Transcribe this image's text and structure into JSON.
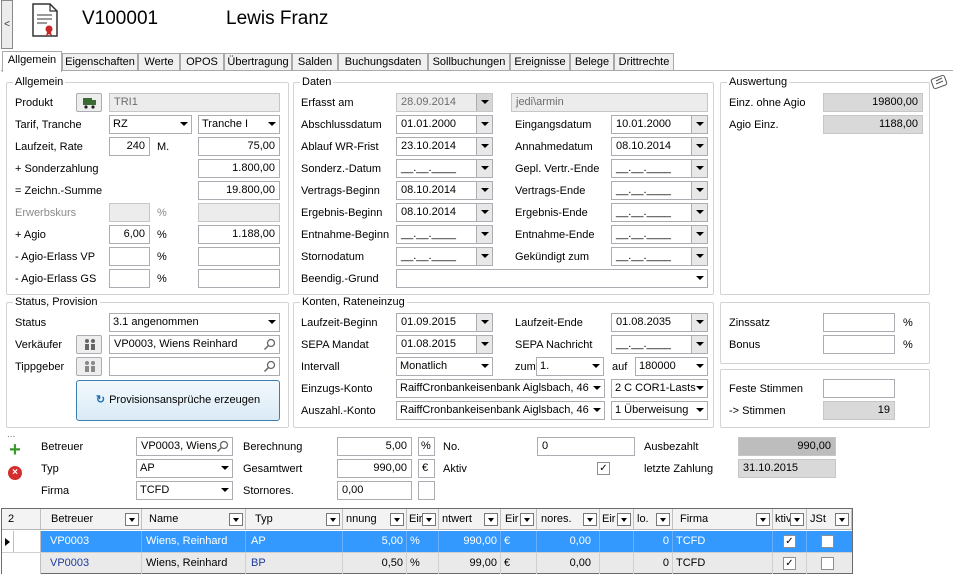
{
  "header": {
    "side_tab": "<",
    "record_id": "V100001",
    "customer_name": "Lewis Franz"
  },
  "tabs": [
    "Allgemein",
    "Eigenschaften",
    "Werte",
    "OPOS",
    "Übertragung",
    "Salden",
    "Buchungsdaten",
    "Sollbuchungen",
    "Ereignisse",
    "Belege",
    "Drittrechte"
  ],
  "allgemein": {
    "title": "Allgemein",
    "produkt_label": "Produkt",
    "produkt_value": "TRI1",
    "tarif_label": "Tarif, Tranche",
    "tarif_value": "RZ",
    "tranche_value": "Tranche I",
    "laufzeit_label": "Laufzeit, Rate",
    "laufzeit_value": "240",
    "laufzeit_unit": "M.",
    "rate_value": "75,00",
    "sonder_label": "+ Sonderzahlung",
    "sonder_value": "1.800,00",
    "zeichn_label": "= Zeichn.-Summe",
    "zeichn_value": "19.800,00",
    "erwerbskurs_label": "Erwerbskurs",
    "erwerbskurs_pct": "%",
    "agio_label": "+ Agio",
    "agio_value": "6,00",
    "agio_pct": "%",
    "agio_amount": "1.188,00",
    "erlass_vp_label": "- Agio-Erlass VP",
    "erlass_vp_pct": "%",
    "erlass_gs_label": "- Agio-Erlass GS",
    "erlass_gs_pct": "%"
  },
  "daten": {
    "title": "Daten",
    "erfasst_label": "Erfasst am",
    "erfasst_value": "28.09.2014",
    "user_value": "jedi\\armin",
    "abschluss_label": "Abschlussdatum",
    "abschluss_value": "01.01.2000",
    "eingang_label": "Eingangsdatum",
    "eingang_value": "10.01.2000",
    "ablauf_label": "Ablauf WR-Frist",
    "ablauf_value": "23.10.2014",
    "annahme_label": "Annahmedatum",
    "annahme_value": "08.10.2014",
    "sonderz_label": "Sonderz.-Datum",
    "sonderz_value": "__.__.____",
    "gepl_label": "Gepl. Vertr.-Ende",
    "gepl_value": "__.__.____",
    "vbeginn_label": "Vertrags-Beginn",
    "vbeginn_value": "08.10.2014",
    "vende_label": "Vertrags-Ende",
    "vende_value": "__.__.____",
    "ebeginn_label": "Ergebnis-Beginn",
    "ebeginn_value": "08.10.2014",
    "eende_label": "Ergebnis-Ende",
    "eende_value": "__.__.____",
    "entbeginn_label": "Entnahme-Beginn",
    "entbeginn_value": "__.__.____",
    "entende_label": "Entnahme-Ende",
    "entende_value": "__.__.____",
    "storno_label": "Stornodatum",
    "storno_value": "__.__.____",
    "gekuendigt_label": "Gekündigt zum",
    "gekuendigt_value": "__.__.____",
    "beendig_label": "Beendig.-Grund",
    "beendig_value": ""
  },
  "auswertung": {
    "title": "Auswertung",
    "einz_label": "Einz. ohne Agio",
    "einz_value": "19800,00",
    "agio_label": "Agio Einz.",
    "agio_value": "1188,00"
  },
  "status": {
    "title": "Status, Provision",
    "status_label": "Status",
    "status_value": "3.1 angenommen",
    "verkaeufer_label": "Verkäufer",
    "verkaeufer_value": "VP0003, Wiens Reinhard",
    "tippgeber_label": "Tippgeber",
    "tippgeber_value": "",
    "prov_button": "Provisionsansprüche erzeugen"
  },
  "konten": {
    "title": "Konten, Rateneinzug",
    "lbeginn_label": "Laufzeit-Beginn",
    "lbeginn_value": "01.09.2015",
    "lende_label": "Laufzeit-Ende",
    "lende_value": "01.08.2035",
    "sepa_label": "SEPA Mandat",
    "sepa_value": "01.08.2015",
    "sepan_label": "SEPA Nachricht",
    "sepan_value": "__.__.____",
    "intervall_label": "Intervall",
    "intervall_value": "Monatlich",
    "zum_label": "zum",
    "zum_value": "1.",
    "auf_label": "auf",
    "auf_value": "180000",
    "einzug_label": "Einzugs-Konto",
    "einzug_value": "RaiffCronbankeisenbank Aiglsbach, 46",
    "einzug_type": "2 C COR1-Lasts",
    "auszahl_label": "Auszahl.-Konto",
    "auszahl_value": "RaiffCronbankeisenbank Aiglsbach, 46",
    "auszahl_type": "1 Überweisung"
  },
  "zins": {
    "zinssatz_label": "Zinssatz",
    "zinssatz_unit": "%",
    "bonus_label": "Bonus",
    "bonus_unit": "%"
  },
  "stimmen": {
    "feste_label": "Feste Stimmen",
    "stimmen_label": "-> Stimmen",
    "stimmen_value": "19"
  },
  "prov_detail": {
    "dots": "...",
    "betreuer_label": "Betreuer",
    "betreuer_value": "VP0003, Wiens",
    "typ_label": "Typ",
    "typ_value": "AP",
    "firma_label": "Firma",
    "firma_value": "TCFD",
    "berechnung_label": "Berechnung",
    "berechnung_value": "5,00",
    "berechnung_unit": "%",
    "gesamt_label": "Gesamtwert",
    "gesamt_value": "990,00",
    "gesamt_unit": "€",
    "storno_label": "Stornores.",
    "storno_value": "0,00",
    "no_label": "No.",
    "no_value": "0",
    "aktiv_label": "Aktiv",
    "aktiv_checked": "✓",
    "ausbezahlt_label": "Ausbezahlt",
    "ausbezahlt_value": "990,00",
    "letzte_label": "letzte Zahlung",
    "letzte_value": "31.10.2015"
  },
  "grid": {
    "count": "2",
    "headers": [
      "Betreuer",
      "Name",
      "Typ",
      "nnung",
      "Eir",
      "ntwert",
      "Eir",
      "nores.",
      "Eir",
      "lo.",
      "Firma",
      "ktiv",
      "JSt"
    ],
    "rows": [
      {
        "betreuer": "VP0003",
        "name": "Wiens, Reinhard",
        "typ": "AP",
        "ber": "5,00",
        "u1": "%",
        "ges": "990,00",
        "u2": "€",
        "sto": "0,00",
        "u3": "",
        "no": "0",
        "firma": "TCFD",
        "aktiv": "✓",
        "jst": ""
      },
      {
        "betreuer": "VP0003",
        "name": "Wiens, Reinhard",
        "typ": "BP",
        "ber": "0,50",
        "u1": "%",
        "ges": "99,00",
        "u2": "€",
        "sto": "0,00",
        "u3": "",
        "no": "0",
        "firma": "TCFD",
        "aktiv": "✓",
        "jst": ""
      }
    ]
  }
}
